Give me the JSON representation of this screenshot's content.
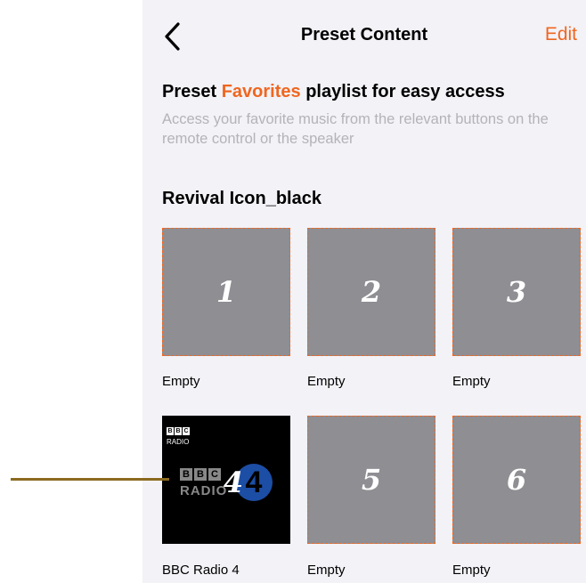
{
  "nav": {
    "title": "Preset Content",
    "edit_label": "Edit"
  },
  "header": {
    "heading_before": "Preset ",
    "heading_accent": "Favorites",
    "heading_after": " playlist for easy access",
    "description": "Access your favorite music from the relevant buttons on the remote control or the speaker"
  },
  "device_name": "Revival Icon_black",
  "presets": [
    {
      "number": "1",
      "label": "Empty"
    },
    {
      "number": "2",
      "label": "Empty"
    },
    {
      "number": "3",
      "label": "Empty"
    },
    {
      "number": "4",
      "label": "BBC Radio 4",
      "logo": {
        "b1": "B",
        "b2": "B",
        "b3": "C",
        "radio": "RADIO",
        "station_num": "4"
      }
    },
    {
      "number": "5",
      "label": "Empty"
    },
    {
      "number": "6",
      "label": "Empty"
    }
  ],
  "colors": {
    "accent": "#f0661f",
    "tile": "#8e8e93",
    "background": "#f2f2f7",
    "pointer": "#8b6a20"
  }
}
